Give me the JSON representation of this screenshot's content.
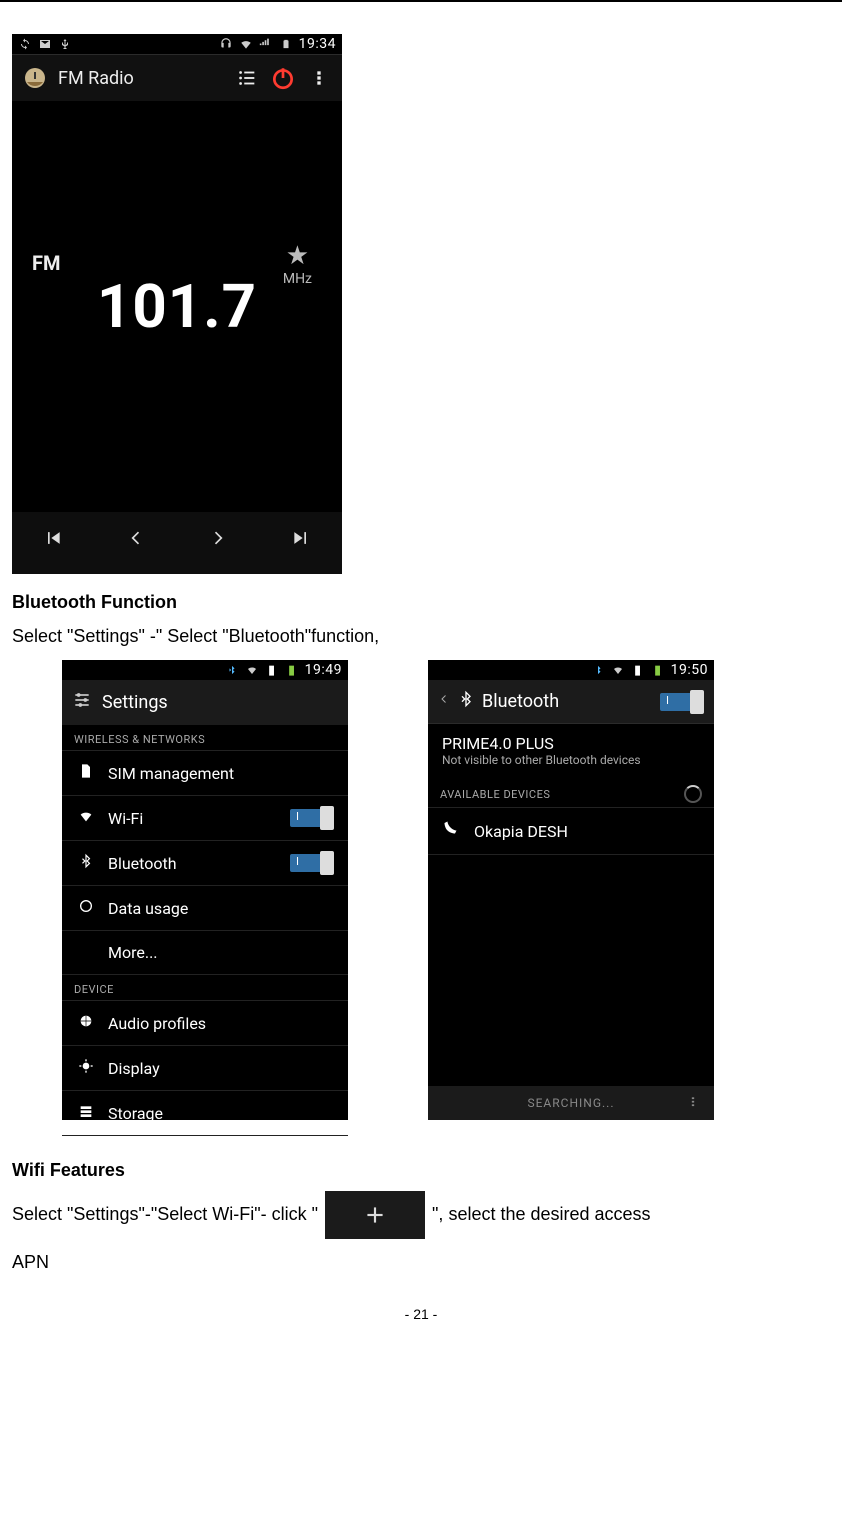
{
  "fm": {
    "statusbar_time": "19:34",
    "app_title": "FM Radio",
    "band_label": "FM",
    "frequency": "101.7",
    "unit": "MHz"
  },
  "doc": {
    "heading_bluetooth": "Bluetooth Function",
    "para_bluetooth": "Select \"Settings\" -\" Select \"Bluetooth\"function,",
    "heading_wifi": "Wifi Features",
    "wifi_para_pre": "Select \"Settings\"-\"Select Wi-Fi\"- click \"",
    "wifi_para_post": "\", select the desired access",
    "apn_line": "APN",
    "page_number": "- 21 -"
  },
  "settings": {
    "statusbar_time": "19:49",
    "title": "Settings",
    "section_wireless": "WIRELESS & NETWORKS",
    "section_device": "DEVICE",
    "items": {
      "sim": "SIM management",
      "wifi": "Wi-Fi",
      "bluetooth": "Bluetooth",
      "data": "Data usage",
      "more": "More...",
      "audio": "Audio profiles",
      "display": "Display",
      "storage": "Storage"
    },
    "switch_label": "I"
  },
  "bluetooth": {
    "statusbar_time": "19:50",
    "title": "Bluetooth",
    "device_name": "PRIME4.0 PLUS",
    "device_sub": "Not visible to other Bluetooth devices",
    "section_available": "AVAILABLE DEVICES",
    "found_device": "Okapia DESH",
    "footer": "SEARCHING...",
    "switch_label": "I"
  }
}
